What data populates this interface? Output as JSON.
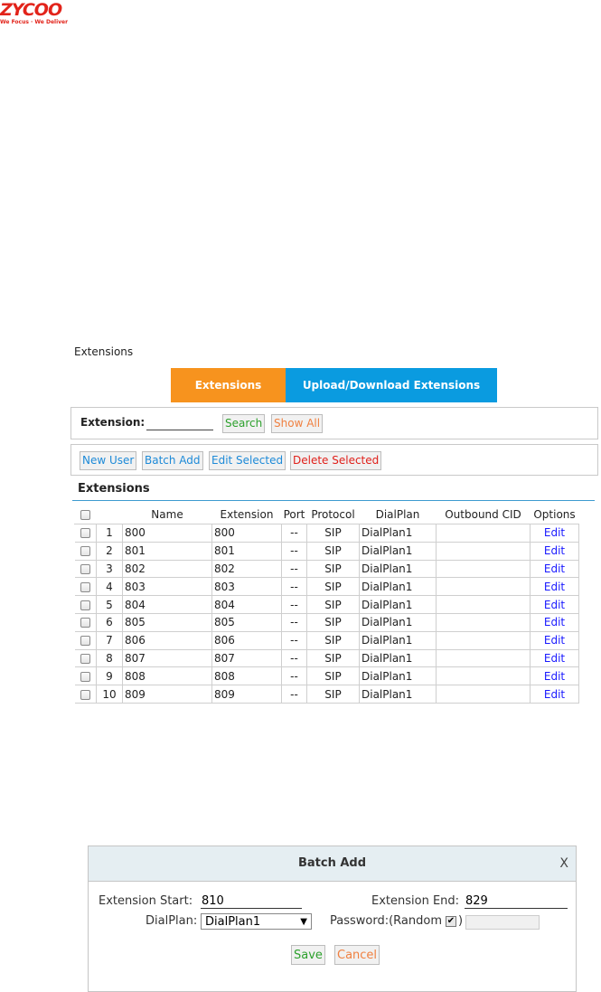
{
  "logo": {
    "name": "ZYCOO",
    "tagline": "We Focus · We Deliver",
    "color": "#e2231a"
  },
  "section_title": "Extensions",
  "tabs": [
    {
      "label": "Extensions",
      "color": "#f7931e",
      "active": true
    },
    {
      "label": "Upload/Download Extensions",
      "color": "#0a9be0",
      "active": false
    }
  ],
  "search": {
    "label": "Extension:",
    "value": "",
    "search_button": "Search",
    "show_all_button": "Show All"
  },
  "actions": {
    "new_user": "New User",
    "batch_add": "Batch Add",
    "edit_selected": "Edit Selected",
    "delete_selected": "Delete Selected"
  },
  "table": {
    "title": "Extensions",
    "columns": [
      "Name",
      "Extension",
      "Port",
      "Protocol",
      "DialPlan",
      "Outbound CID",
      "Options"
    ],
    "rows": [
      {
        "index": "1",
        "name": "800",
        "extension": "800",
        "port": "--",
        "protocol": "SIP",
        "dialplan": "DialPlan1",
        "outbound_cid": "",
        "option": "Edit"
      },
      {
        "index": "2",
        "name": "801",
        "extension": "801",
        "port": "--",
        "protocol": "SIP",
        "dialplan": "DialPlan1",
        "outbound_cid": "",
        "option": "Edit"
      },
      {
        "index": "3",
        "name": "802",
        "extension": "802",
        "port": "--",
        "protocol": "SIP",
        "dialplan": "DialPlan1",
        "outbound_cid": "",
        "option": "Edit"
      },
      {
        "index": "4",
        "name": "803",
        "extension": "803",
        "port": "--",
        "protocol": "SIP",
        "dialplan": "DialPlan1",
        "outbound_cid": "",
        "option": "Edit"
      },
      {
        "index": "5",
        "name": "804",
        "extension": "804",
        "port": "--",
        "protocol": "SIP",
        "dialplan": "DialPlan1",
        "outbound_cid": "",
        "option": "Edit"
      },
      {
        "index": "6",
        "name": "805",
        "extension": "805",
        "port": "--",
        "protocol": "SIP",
        "dialplan": "DialPlan1",
        "outbound_cid": "",
        "option": "Edit"
      },
      {
        "index": "7",
        "name": "806",
        "extension": "806",
        "port": "--",
        "protocol": "SIP",
        "dialplan": "DialPlan1",
        "outbound_cid": "",
        "option": "Edit"
      },
      {
        "index": "8",
        "name": "807",
        "extension": "807",
        "port": "--",
        "protocol": "SIP",
        "dialplan": "DialPlan1",
        "outbound_cid": "",
        "option": "Edit"
      },
      {
        "index": "9",
        "name": "808",
        "extension": "808",
        "port": "--",
        "protocol": "SIP",
        "dialplan": "DialPlan1",
        "outbound_cid": "",
        "option": "Edit"
      },
      {
        "index": "10",
        "name": "809",
        "extension": "809",
        "port": "--",
        "protocol": "SIP",
        "dialplan": "DialPlan1",
        "outbound_cid": "",
        "option": "Edit"
      }
    ]
  },
  "dialog": {
    "title": "Batch Add",
    "close": "X",
    "ext_start_label": "Extension Start:",
    "ext_start_value": "810",
    "ext_end_label": "Extension End:",
    "ext_end_value": "829",
    "dialplan_label": "DialPlan:",
    "dialplan_value": "DialPlan1",
    "password_label": "Password:(Random",
    "password_close": ")",
    "random_checked": true,
    "save": "Save",
    "cancel": "Cancel"
  }
}
